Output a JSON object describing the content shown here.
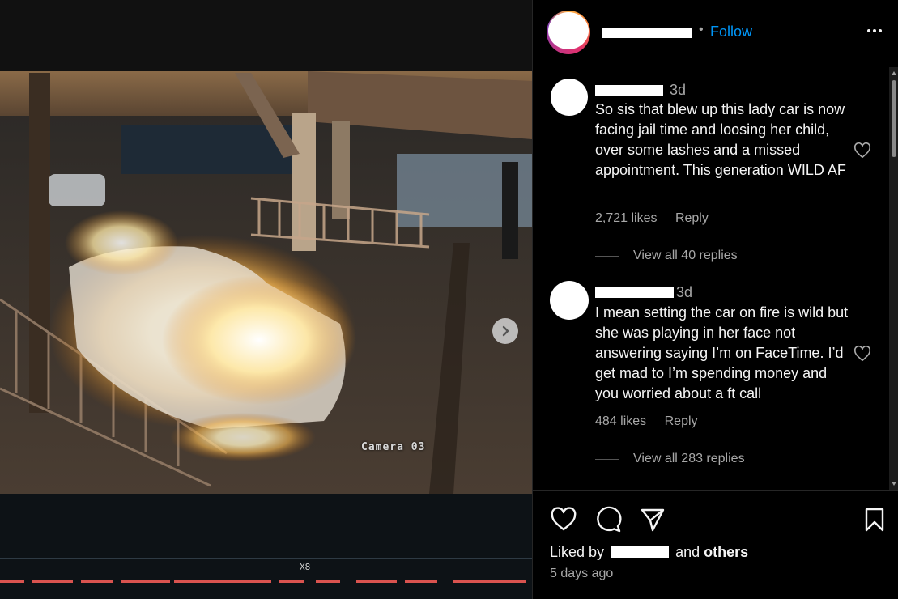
{
  "media": {
    "camera_label": "Camera 03",
    "progress_label": "X8"
  },
  "header": {
    "separator": "•",
    "follow_label": "Follow",
    "more_icon": "more-horizontal-icon"
  },
  "comments": [
    {
      "time": "3d",
      "text": "So sis that blew up this lady car is now facing jail time and loosing her child, over some lashes and a missed appointment. This generation WILD AF",
      "likes": "2,721 likes",
      "reply_label": "Reply",
      "replies_label": "View all 40 replies"
    },
    {
      "time": "3d",
      "text": "I mean setting the car on fire is wild but she was playing in her face not answering saying I’m on FaceTime. I’d get mad to I’m spending money and you worried about a ft call",
      "likes": "484 likes",
      "reply_label": "Reply",
      "replies_label": "View all 283 replies"
    }
  ],
  "footer": {
    "liked_by_prefix": "Liked by",
    "and": "and",
    "others": "others",
    "post_time": "5 days ago"
  },
  "colors": {
    "accent_blue": "#0095f6",
    "muted_text": "#a8a8a8",
    "background": "#000000"
  }
}
